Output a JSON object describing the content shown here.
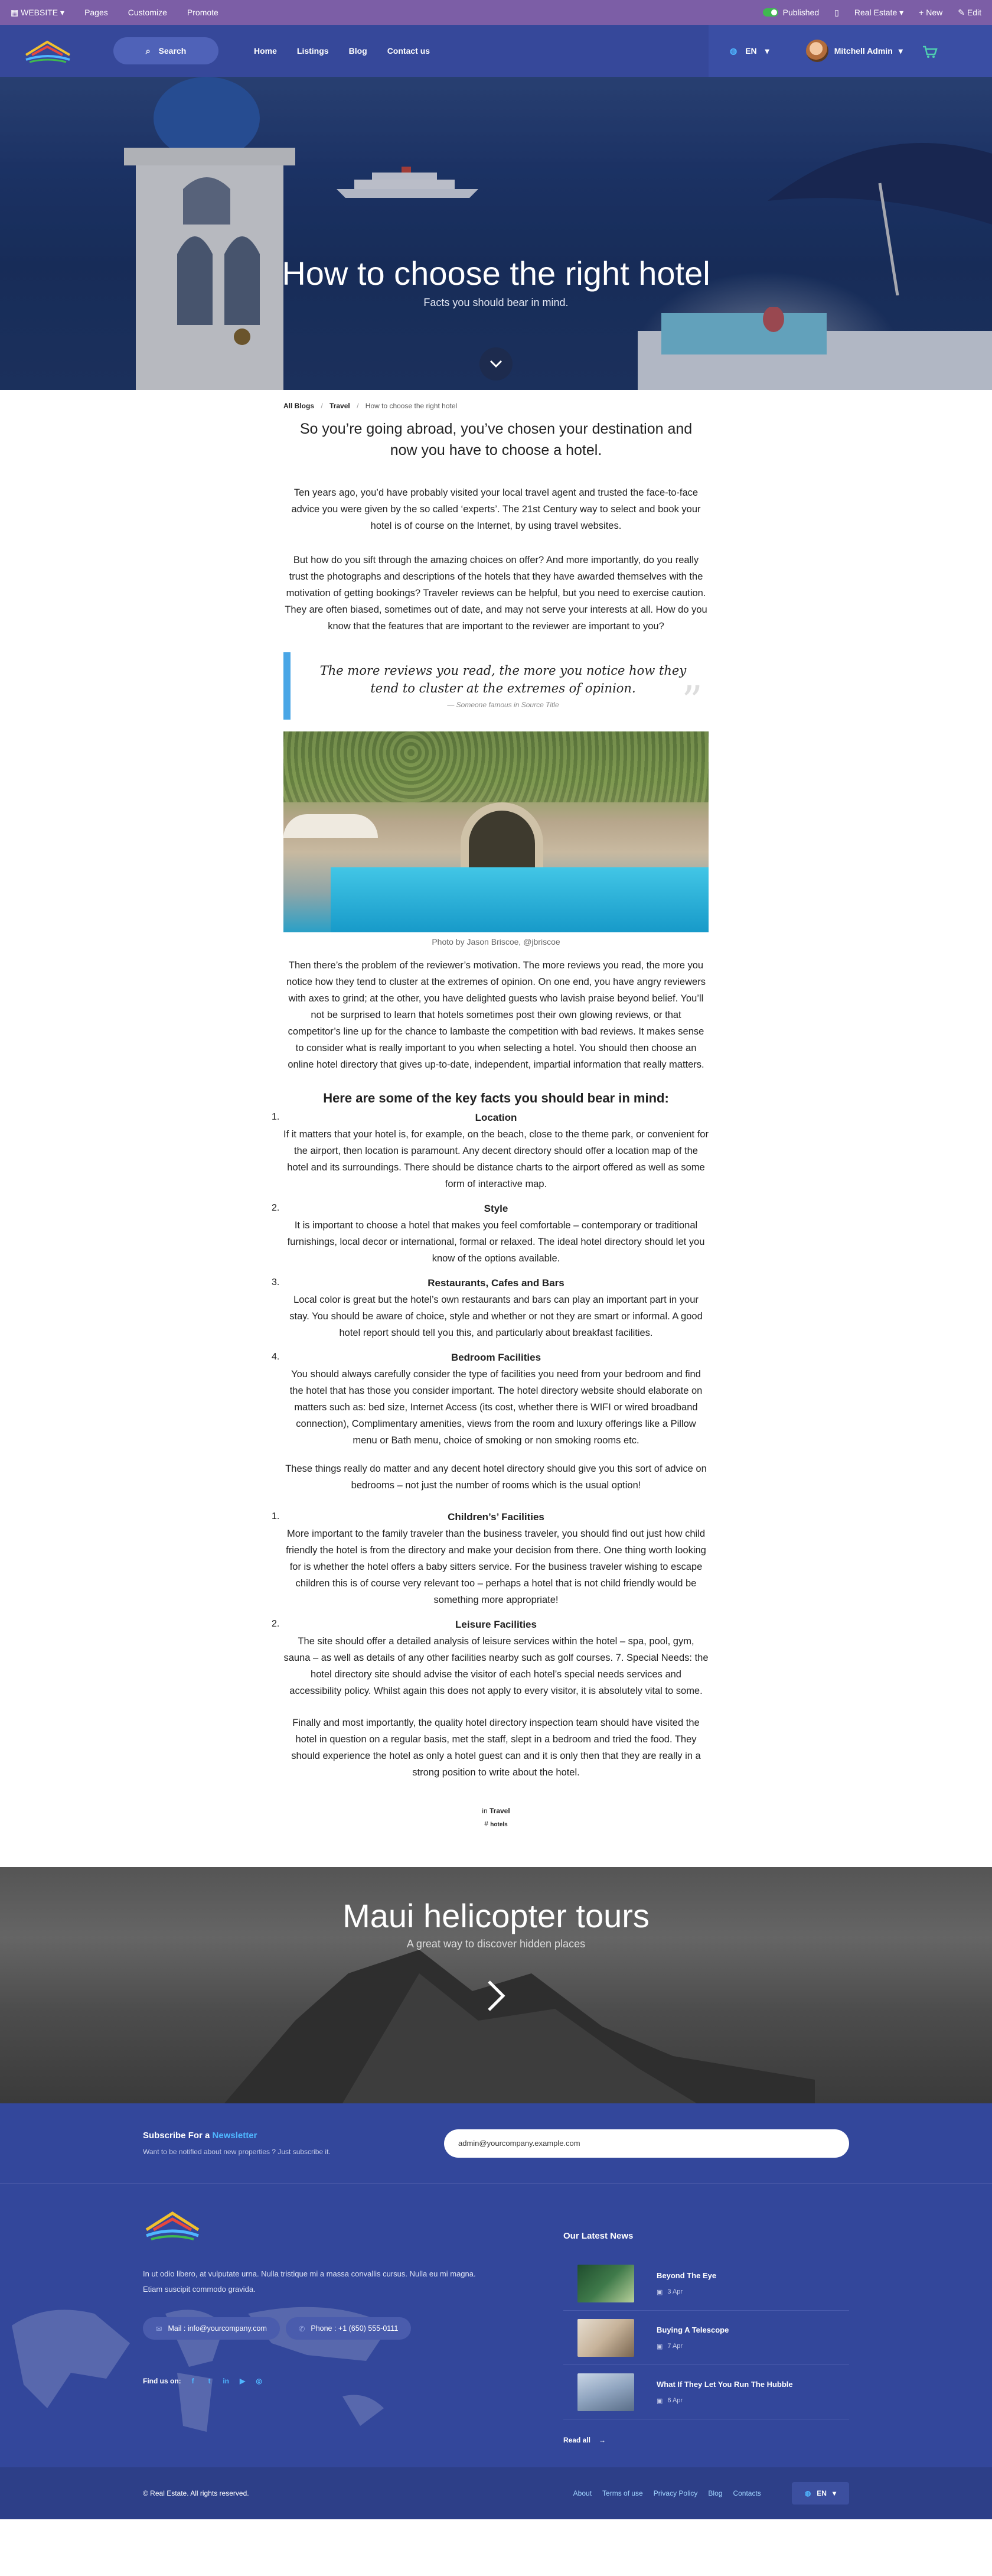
{
  "adminbar": {
    "website": "WEBSITE",
    "pages": "Pages",
    "customize": "Customize",
    "promote": "Promote",
    "published": "Published",
    "site_name": "Real Estate",
    "new": "New",
    "edit": "Edit"
  },
  "nav": {
    "search": "Search",
    "menu": [
      "Home",
      "Listings",
      "Blog",
      "Contact us"
    ],
    "lang": "EN",
    "user": "Mitchell Admin"
  },
  "hero": {
    "title": "How to choose the right hotel",
    "subtitle": "Facts you should bear in mind."
  },
  "breadcrumb": [
    "All Blogs",
    "Travel",
    "How to choose the right hotel"
  ],
  "article": {
    "lead": "So you’re going abroad, you’ve chosen your destination and now you have to choose a hotel.",
    "p1": "Ten years ago, you’d have probably visited your local travel agent and trusted the face-to-face advice you were given by the so called ‘experts’. The 21st Century way to select and book your hotel is of course on the Internet, by using travel websites.",
    "p2": "But how do you sift through the amazing choices on offer? And more importantly, do you really trust the photographs and descriptions of the hotels that they have awarded themselves with the motivation of getting bookings? Traveler reviews can be helpful, but you need to exercise caution. They are often biased, sometimes out of date, and may not serve your interests at all. How do you know that the features that are important to the reviewer are important to you?",
    "quote": "The more reviews you read, the more you notice how they tend to cluster at the extremes of opinion.",
    "quote_cite": "— Someone famous in Source Title",
    "caption": "Photo by Jason Briscoe, @jbriscoe",
    "p3": "Then there’s the problem of the reviewer’s motivation. The more reviews you read, the more you notice how they tend to cluster at the extremes of opinion. On one end, you have angry reviewers with axes to grind; at the other, you have delighted guests who lavish praise beyond belief. You’ll not be surprised to learn that hotels sometimes post their own glowing reviews, or that competitor’s line up for the chance to lambaste the competition with bad reviews. It makes sense to consider what is really important to you when selecting a hotel. You should then choose an online hotel directory that gives up-to-date, independent, impartial information that really matters.",
    "facts_title": "Here are some of the key facts you should bear in mind:",
    "facts": [
      {
        "num": "1.",
        "title": "Location",
        "text": "If it matters that your hotel is, for example, on the beach, close to the theme park, or convenient for the airport, then location is paramount. Any decent directory should offer a location map of the hotel and its surroundings. There should be distance charts to the airport offered as well as some form of interactive map."
      },
      {
        "num": "2.",
        "title": "Style",
        "text": "It is important to choose a hotel that makes you feel comfortable – contemporary or traditional furnishings, local decor or international, formal or relaxed. The ideal hotel directory should let you know of the options available."
      },
      {
        "num": "3.",
        "title": "Restaurants, Cafes and Bars",
        "text": "Local color is great but the hotel’s own restaurants and bars can play an important part in your stay. You should be aware of choice, style and whether or not they are smart or informal. A good hotel report should tell you this, and particularly about breakfast facilities."
      },
      {
        "num": "4.",
        "title": "Bedroom Facilities",
        "text": "You should always carefully consider the type of facilities you need from your bedroom and find the hotel that has those you consider important. The hotel directory website should elaborate on matters such as: bed size, Internet Access (its cost, whether there is WIFI or wired broadband connection), Complimentary amenities, views from the room and luxury offerings like a Pillow menu or Bath menu, choice of smoking or non smoking rooms etc."
      }
    ],
    "p4": "These things really do matter and any decent hotel directory should give you this sort of advice on bedrooms – not just the number of rooms which is the usual option!",
    "facts2": [
      {
        "num": "1.",
        "title": "Children’s’ Facilities",
        "text": "More important to the family traveler than the business traveler, you should find out just how child friendly the hotel is from the directory and make your decision from there. One thing worth looking for is whether the hotel offers a baby sitters service. For the business traveler wishing to escape children this is of course very relevant too – perhaps a hotel that is not child friendly would be something more appropriate!"
      },
      {
        "num": "2.",
        "title": "Leisure Facilities",
        "text": "The site should offer a detailed analysis of leisure services within the hotel – spa, pool, gym, sauna – as well as details of any other facilities nearby such as golf courses. 7. Special Needs: the hotel directory site should advise the visitor of each hotel’s special needs services and accessibility policy. Whilst again this does not apply to every visitor, it is absolutely vital to some."
      }
    ],
    "p5": "Finally and most importantly, the quality hotel directory inspection team should have visited the hotel in question on a regular basis, met the staff, slept in a bedroom and tried the food. They should experience the hotel as only a hotel guest can and it is only then that they are really in a strong position to write about the hotel.",
    "in_label": "in",
    "category": "Travel",
    "tag": "hotels"
  },
  "next_post": {
    "title": "Maui helicopter tours",
    "subtitle": "A great way to discover hidden places"
  },
  "subscribe": {
    "title_prefix": "Subscribe For a",
    "title_highlight": "Newsletter",
    "text": "Want to be notified about new properties ? Just subscribe it.",
    "email": "admin@yourcompany.example.com"
  },
  "footer": {
    "about": "In ut odio libero, at vulputate urna. Nulla tristique mi a massa convallis cursus. Nulla eu mi magna. Etiam suscipit commodo gravida.",
    "mail": "Mail : info@yourcompany.com",
    "phone": "Phone : +1 (650) 555-0111",
    "find_us": "Find us on:",
    "news_title": "Our Latest News",
    "news": [
      {
        "title": "Beyond The Eye",
        "date": "3 Apr",
        "color": "#2b5a3a"
      },
      {
        "title": "Buying A Telescope",
        "date": "7 Apr",
        "color": "#c7b39a"
      },
      {
        "title": "What If They Let You Run The Hubble",
        "date": "6 Apr",
        "color": "#8fa4bf"
      }
    ],
    "read_all": "Read all",
    "copyright": "© Real Estate. All rights reserved.",
    "links": [
      "About",
      "Terms of use",
      "Privacy Policy",
      "Blog",
      "Contacts"
    ],
    "lang": "EN"
  }
}
